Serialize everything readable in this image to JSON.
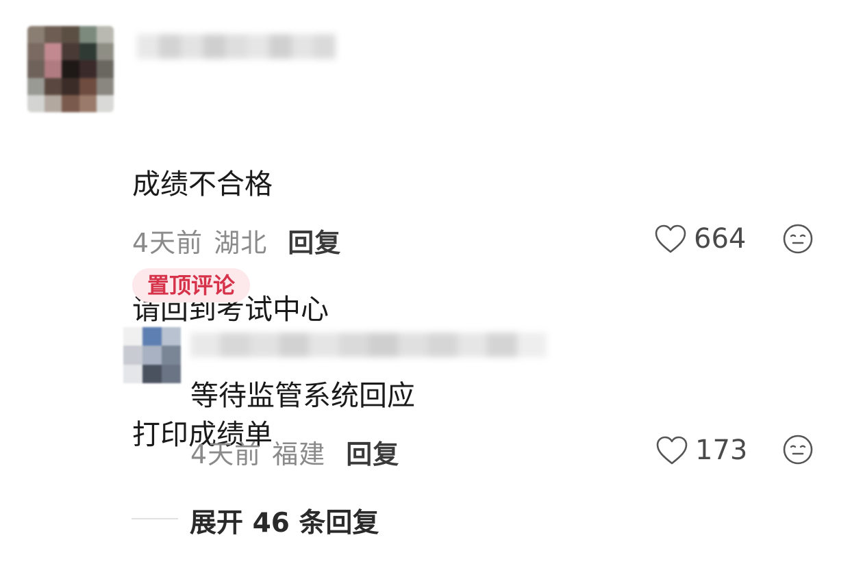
{
  "comment": {
    "text_lines": [
      "成绩不合格",
      "请回到考试中心",
      "打印成绩单"
    ],
    "time": "4天前",
    "location": "湖北",
    "reply_label": "回复",
    "likes": "664",
    "pinned_label": "置顶评论"
  },
  "reply": {
    "text": "等待监管系统回应",
    "time": "4天前",
    "location": "福建",
    "reply_label": "回复",
    "likes": "173"
  },
  "expand_label": "展开 46 条回复",
  "icons": {
    "like": "heart-outline-icon",
    "dislike": "expressionless-face-icon"
  },
  "colors": {
    "pinned_bg": "#fde8ec",
    "pinned_text": "#d6334b",
    "meta_text": "#8a8a8a"
  }
}
